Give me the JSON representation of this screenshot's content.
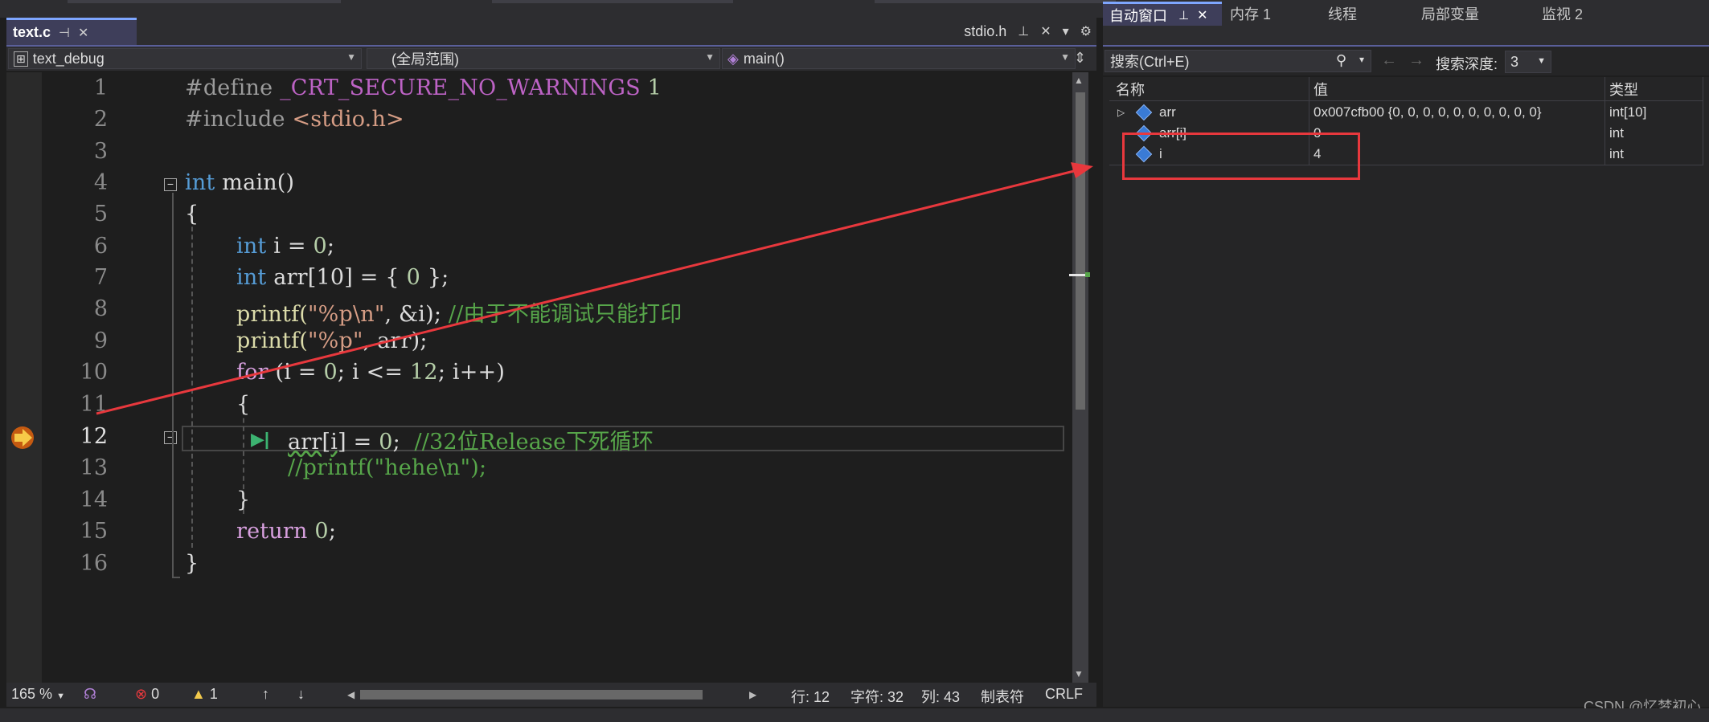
{
  "editor": {
    "tabs": {
      "active": "text.c",
      "other": "stdio.h"
    },
    "nav": {
      "project": "text_debug",
      "scope": "(全局范围)",
      "function": "main()"
    },
    "line_numbers": [
      "1",
      "2",
      "3",
      "4",
      "5",
      "6",
      "7",
      "8",
      "9",
      "10",
      "11",
      "12",
      "13",
      "14",
      "15",
      "16"
    ],
    "code": {
      "l1_a": "#define ",
      "l1_b": "_CRT_SECURE_NO_WARNINGS",
      "l1_c": " 1",
      "l2_a": "#include ",
      "l2_b": "<stdio.h>",
      "l4_a": "int",
      "l4_b": " main()",
      "l5": "{",
      "l6_a": "int",
      "l6_b": " i = ",
      "l6_c": "0",
      "l6_d": ";",
      "l7_a": "int",
      "l7_b": " arr[10] = { ",
      "l7_c": "0",
      "l7_d": " };",
      "l8_a": "printf(",
      "l8_b": "\"%p\\n\"",
      "l8_c": ", &i); ",
      "l8_d": "//由于不能调试只能打印",
      "l9_a": "printf(",
      "l9_b": "\"%p\"",
      "l9_c": ", arr);",
      "l10_a": "for",
      "l10_b": " (i = ",
      "l10_c": "0",
      "l10_d": "; i <= ",
      "l10_e": "12",
      "l10_f": "; i++)",
      "l11": "{",
      "l12_a": "arr[i]",
      "l12_b": " = ",
      "l12_c": "0",
      "l12_d": ";  ",
      "l12_e": "//32位Release下死循环",
      "l13": "//printf(\"hehe\\n\");",
      "l14": "}",
      "l15_a": "return",
      "l15_b": " ",
      "l15_c": "0",
      "l15_d": ";",
      "l16": "}"
    },
    "current_line": "12",
    "status": {
      "zoom": "165 %",
      "errors": "0",
      "warnings": "1",
      "line": "行: 12",
      "char": "字符: 32",
      "col": "列: 43",
      "tabs": "制表符",
      "eol": "CRLF"
    }
  },
  "autos_panel": {
    "tabs": [
      "自动窗口",
      "内存 1",
      "线程",
      "局部变量",
      "监视 2"
    ],
    "search_placeholder": "搜索(Ctrl+E)",
    "depth_label": "搜索深度:",
    "depth_value": "3",
    "columns": {
      "name": "名称",
      "value": "值",
      "type": "类型"
    },
    "rows": [
      {
        "name": "arr",
        "value": "0x007cfb00 {0, 0, 0, 0, 0, 0, 0, 0, 0, 0}",
        "type": "int[10]"
      },
      {
        "name": "arr[i]",
        "value": "0",
        "type": "int"
      },
      {
        "name": "i",
        "value": "4",
        "type": "int"
      }
    ]
  },
  "annotation_color": "#e8383d",
  "watermark": "CSDN @忆梦初心"
}
